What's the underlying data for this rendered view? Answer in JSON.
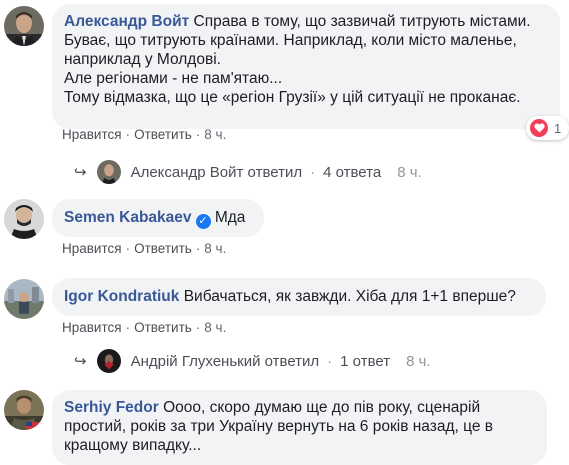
{
  "comments": [
    {
      "author": "Александр Войт",
      "lines": [
        "Справа в тому, що зазвичай титрують містами.",
        "Буває, що титрують країнами. Наприклад, коли місто маленье,",
        "наприклад у Молдові.",
        "Але регіонами - не пам'ятаю...",
        "Тому відмазка, що це «регіон Грузії» у цій ситуації не проканає."
      ],
      "actions": {
        "like": "Нравится",
        "reply": "Ответить",
        "time": "8 ч."
      },
      "reactions": {
        "icon": "heart-icon",
        "count": "1"
      },
      "reply_summary": {
        "text": "Александр Войт ответил",
        "count": "4 ответа",
        "time": "8 ч."
      }
    },
    {
      "author": "Semen Kabakaev",
      "verified": true,
      "text": "Мда",
      "actions": {
        "like": "Нравится",
        "reply": "Ответить",
        "time": "8 ч."
      }
    },
    {
      "author": "Igor Kondratiuk",
      "text": "Вибачаться, як завжди. Хіба для 1+1 вперше?",
      "actions": {
        "like": "Нравится",
        "reply": "Ответить",
        "time": "8 ч."
      },
      "reply_summary": {
        "text": "Андрій Глухенький ответил",
        "count": "1 ответ",
        "time": "8 ч."
      }
    },
    {
      "author": "Serhiy Fedor",
      "lines": [
        "Оооо, скоро думаю ще до пів року, сценарій",
        "простий, років за три Україну вернуть на 6 років назад, це в",
        "кращому випадку..."
      ]
    }
  ],
  "colors": {
    "author": "#385898",
    "bubble": "#f2f3f5",
    "heart": "#f33e58",
    "verified": "#1877f2"
  }
}
